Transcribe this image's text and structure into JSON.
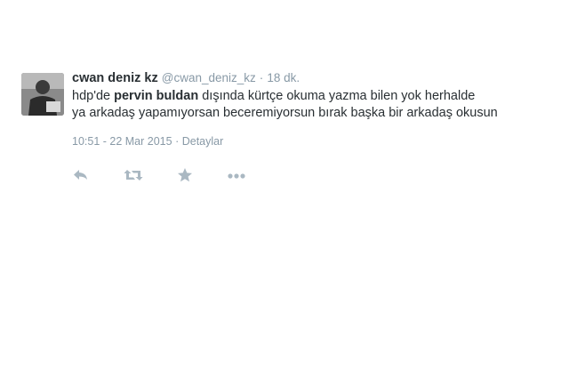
{
  "tweet": {
    "fullname": "cwan deniz kz",
    "username": "@cwan_deniz_kz",
    "separator": "·",
    "relative_time": "18 dk.",
    "text_prefix": "hdp'de ",
    "text_bold": "pervin buldan",
    "text_line1_rest": " dışında kürtçe okuma yazma bilen yok herhalde",
    "text_line2": "ya arkadaş yapamıyorsan beceremiyorsun bırak başka bir arkadaş okusun",
    "timestamp": "10:51 - 22 Mar 2015",
    "meta_separator": "·",
    "details_link": "Detaylar"
  },
  "actions": {
    "reply_icon": "reply-icon",
    "retweet_icon": "retweet-icon",
    "favorite_icon": "star-icon",
    "more_icon": "more-dots-icon",
    "icon_color": "#aab8c2"
  }
}
